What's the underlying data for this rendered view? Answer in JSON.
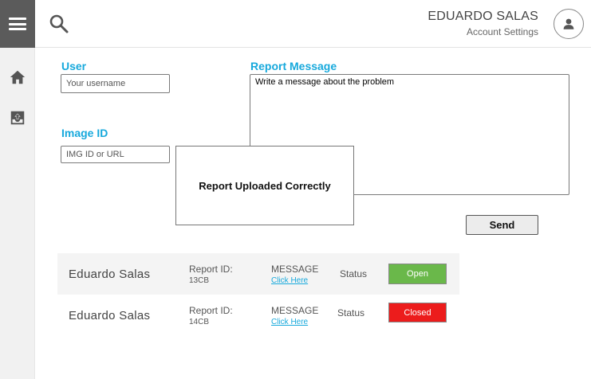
{
  "header": {
    "user_name": "EDUARDO SALAS",
    "account_link": "Account Settings"
  },
  "icons": {
    "menu": "hamburger-icon",
    "search": "search-icon",
    "home": "home-icon",
    "upload": "upload-icon",
    "avatar": "user-icon"
  },
  "form": {
    "user_label": "User",
    "user_placeholder": "Your username",
    "image_label": "Image ID",
    "image_placeholder": "IMG ID or URL",
    "message_label": "Report Message",
    "message_placeholder": "Write a message about the problem",
    "send_label": "Send"
  },
  "toast": {
    "message": "Report Uploaded Correctly"
  },
  "reports": [
    {
      "name": "Eduardo Salas",
      "id_label": "Report ID:",
      "id_value": "13CB",
      "message_label": "MESSAGE",
      "message_link": "Click Here",
      "status_label": "Status",
      "status": "Open",
      "status_color": "#6ab84a"
    },
    {
      "name": "Eduardo Salas",
      "id_label": "Report ID:",
      "id_value": "14CB",
      "message_label": "MESSAGE",
      "message_link": "Click Here",
      "status_label": "Status",
      "status": "Closed",
      "status_color": "#ec1c1c"
    }
  ],
  "colors": {
    "accent": "#17a9dc",
    "menu_bg": "#5b5b5b",
    "rail_bg": "#f1f1f1"
  }
}
